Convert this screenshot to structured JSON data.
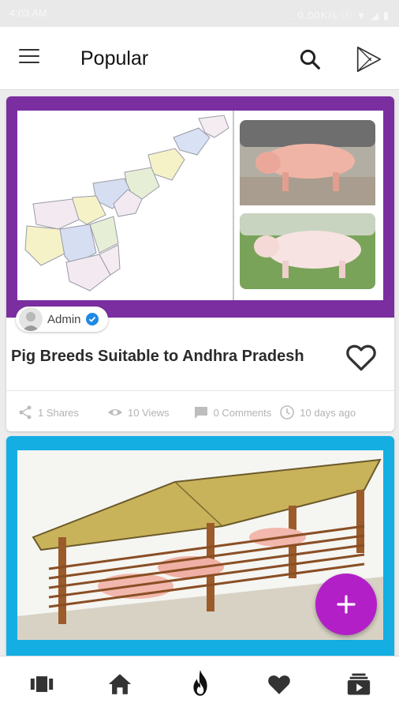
{
  "status_bar": {
    "time": "4:03 AM",
    "right": "... 0.00K/s  ⓢ  ▼  ◢  ▮"
  },
  "app_bar": {
    "title": "Popular"
  },
  "posts": [
    {
      "author": "Admin",
      "verified": true,
      "title": "Pig Breeds Suitable to Andhra Pradesh",
      "accent": "#7b2ea0",
      "shares": "1 Shares",
      "views": "10 Views",
      "comments": "0 Comments",
      "time_ago": "10 days ago"
    },
    {
      "accent": "#14aee3"
    }
  ],
  "fab": {
    "icon": "plus-icon",
    "color": "#b21fc7"
  },
  "bottom_nav": {
    "items": [
      "carousel-icon",
      "home-icon",
      "fire-icon",
      "heart-icon",
      "video-library-icon"
    ],
    "active": "fire-icon"
  }
}
